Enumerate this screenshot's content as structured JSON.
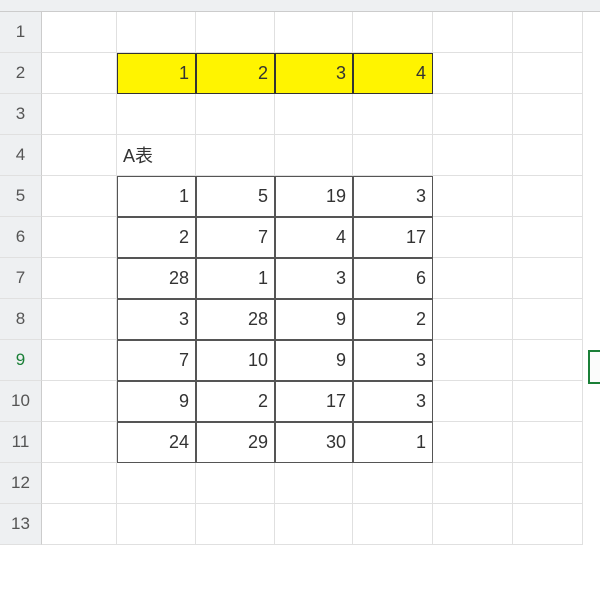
{
  "row_headers": [
    "1",
    "2",
    "3",
    "4",
    "5",
    "6",
    "7",
    "8",
    "9",
    "10",
    "11",
    "12",
    "13"
  ],
  "selected_row": "9",
  "hdr": {
    "c1": "1",
    "c2": "2",
    "c3": "3",
    "c4": "4"
  },
  "label": {
    "a_table": "A表"
  },
  "tbl": {
    "r5": {
      "c1": "1",
      "c2": "5",
      "c3": "19",
      "c4": "3"
    },
    "r6": {
      "c1": "2",
      "c2": "7",
      "c3": "4",
      "c4": "17"
    },
    "r7": {
      "c1": "28",
      "c2": "1",
      "c3": "3",
      "c4": "6"
    },
    "r8": {
      "c1": "3",
      "c2": "28",
      "c3": "9",
      "c4": "2"
    },
    "r9": {
      "c1": "7",
      "c2": "10",
      "c3": "9",
      "c4": "3"
    },
    "r10": {
      "c1": "9",
      "c2": "2",
      "c3": "17",
      "c4": "3"
    },
    "r11": {
      "c1": "24",
      "c2": "29",
      "c3": "30",
      "c4": "1"
    }
  },
  "chart_data": {
    "type": "table",
    "title": "A表",
    "header_row": [
      1,
      2,
      3,
      4
    ],
    "values": [
      [
        1,
        5,
        19,
        3
      ],
      [
        2,
        7,
        4,
        17
      ],
      [
        28,
        1,
        3,
        6
      ],
      [
        3,
        28,
        9,
        2
      ],
      [
        7,
        10,
        9,
        3
      ],
      [
        9,
        2,
        17,
        3
      ],
      [
        24,
        29,
        30,
        1
      ]
    ]
  }
}
